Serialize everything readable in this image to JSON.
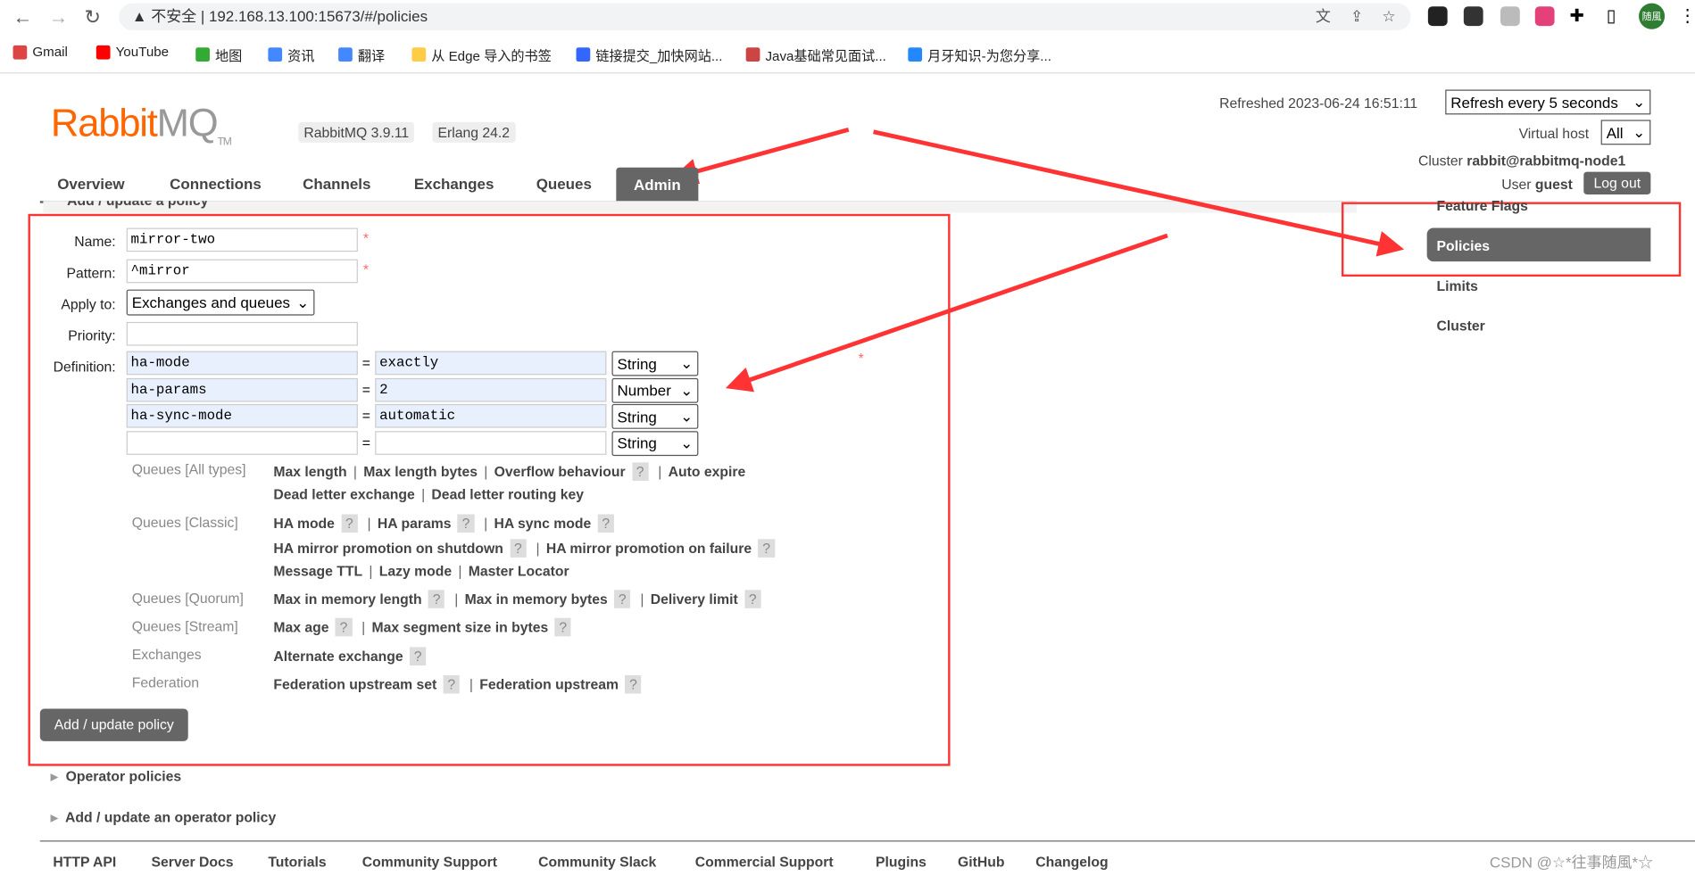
{
  "browser": {
    "security": "不安全",
    "url": "192.168.13.100:15673/#/policies",
    "profile": "随風",
    "bookmarks": [
      "Gmail",
      "YouTube",
      "地图",
      "资讯",
      "翻译",
      "从 Edge 导入的书签",
      "链接提交_加快网站...",
      "Java基础常见面试...",
      "月牙知识-为您分享..."
    ]
  },
  "header": {
    "logo_main": "Rabbit",
    "logo_mq": "MQ",
    "logo_tm": "TM",
    "version": "RabbitMQ 3.9.11",
    "erlang": "Erlang 24.2",
    "refreshed": "Refreshed 2023-06-24 16:51:11",
    "refresh_select": "Refresh every 5 seconds",
    "vhost_label": "Virtual host",
    "vhost_value": "All",
    "cluster_label": "Cluster",
    "cluster_value": "rabbit@rabbitmq-node1",
    "user_label": "User",
    "user_value": "guest",
    "logout": "Log out"
  },
  "tabs": [
    "Overview",
    "Connections",
    "Channels",
    "Exchanges",
    "Queues",
    "Admin"
  ],
  "section_title": "Add / update a policy",
  "form": {
    "name_label": "Name:",
    "name_value": "mirror-two",
    "pattern_label": "Pattern:",
    "pattern_value": "^mirror",
    "apply_label": "Apply to:",
    "apply_value": "Exchanges and queues",
    "priority_label": "Priority:",
    "priority_value": "",
    "definition_label": "Definition:",
    "required": "*",
    "eq": "=",
    "definition": [
      {
        "key": "ha-mode",
        "value": "exactly",
        "type": "String"
      },
      {
        "key": "ha-params",
        "value": "2",
        "type": "Number"
      },
      {
        "key": "ha-sync-mode",
        "value": "automatic",
        "type": "String"
      },
      {
        "key": "",
        "value": "",
        "type": "String"
      }
    ],
    "submit": "Add / update policy"
  },
  "help": [
    {
      "category": "Queues [All types]",
      "lines": [
        [
          {
            "t": "Max length"
          },
          {
            "t": "Max length bytes"
          },
          {
            "t": "Overflow behaviour",
            "q": true
          },
          {
            "t": "Auto expire"
          }
        ],
        [
          {
            "t": "Dead letter exchange"
          },
          {
            "t": "Dead letter routing key"
          }
        ]
      ]
    },
    {
      "category": "Queues [Classic]",
      "lines": [
        [
          {
            "t": "HA mode",
            "q": true
          },
          {
            "t": "HA params",
            "q": true
          },
          {
            "t": "HA sync mode",
            "q": true
          }
        ],
        [
          {
            "t": "HA mirror promotion on shutdown",
            "q": true
          },
          {
            "t": "HA mirror promotion on failure",
            "q": true
          }
        ],
        [
          {
            "t": "Message TTL"
          },
          {
            "t": "Lazy mode"
          },
          {
            "t": "Master Locator"
          }
        ]
      ]
    },
    {
      "category": "Queues [Quorum]",
      "lines": [
        [
          {
            "t": "Max in memory length",
            "q": true
          },
          {
            "t": "Max in memory bytes",
            "q": true
          },
          {
            "t": "Delivery limit",
            "q": true
          }
        ]
      ]
    },
    {
      "category": "Queues [Stream]",
      "lines": [
        [
          {
            "t": "Max age",
            "q": true
          },
          {
            "t": "Max segment size in bytes",
            "q": true
          }
        ]
      ]
    },
    {
      "category": "Exchanges",
      "lines": [
        [
          {
            "t": "Alternate exchange",
            "q": true
          }
        ]
      ]
    },
    {
      "category": "Federation",
      "lines": [
        [
          {
            "t": "Federation upstream set",
            "q": true
          },
          {
            "t": "Federation upstream",
            "q": true
          }
        ]
      ]
    }
  ],
  "help_q": "?",
  "sections": [
    "Operator policies",
    "Add / update an operator policy"
  ],
  "sidebar": [
    "Feature Flags",
    "Policies",
    "Limits",
    "Cluster"
  ],
  "footer": [
    "HTTP API",
    "Server Docs",
    "Tutorials",
    "Community Support",
    "Community Slack",
    "Commercial Support",
    "Plugins",
    "GitHub",
    "Changelog"
  ],
  "watermark": "CSDN @☆*往事随風*☆",
  "colors": {
    "brand": "#ff6600",
    "tab_active": "#666666",
    "annotation": "#ff3333"
  }
}
